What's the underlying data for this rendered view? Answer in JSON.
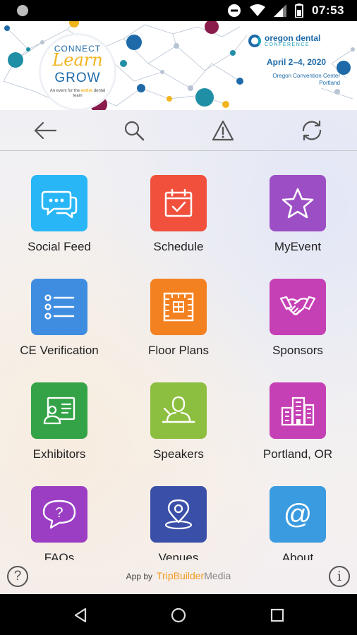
{
  "status_bar": {
    "time": "07:53"
  },
  "banner": {
    "connect": "CONNECT",
    "learn": "Learn",
    "grow": "GROW",
    "tagline_pre": "An event for the",
    "tagline_highlight": "entire",
    "tagline_post": "dental team",
    "org_name": "oregon dental",
    "org_sub": "CONFERENCE",
    "dates": "April 2–4, 2020",
    "venue_line1": "Oregon Convention Center",
    "venue_line2": "Portland"
  },
  "toolbar": {
    "back_icon": "arrow-left",
    "search_icon": "magnifier",
    "alert_icon": "warning-triangle",
    "refresh_icon": "refresh"
  },
  "tiles": [
    {
      "label": "Social Feed",
      "color": "#29b6f6",
      "icon": "chat-bubbles"
    },
    {
      "label": "Schedule",
      "color": "#f0503c",
      "icon": "calendar-check"
    },
    {
      "label": "MyEvent",
      "color": "#9c4fc4",
      "icon": "star"
    },
    {
      "label": "CE Verification",
      "color": "#3f8de0",
      "icon": "list"
    },
    {
      "label": "Floor Plans",
      "color": "#f48120",
      "icon": "floor-plan"
    },
    {
      "label": "Sponsors",
      "color": "#c640b5",
      "icon": "handshake"
    },
    {
      "label": "Exhibitors",
      "color": "#34a347",
      "icon": "exhibitor-board"
    },
    {
      "label": "Speakers",
      "color": "#8cbf3f",
      "icon": "speaker-podium"
    },
    {
      "label": "Portland, OR",
      "color": "#c640b5",
      "icon": "city-buildings"
    },
    {
      "label": "FAQs",
      "color": "#9b3ec4",
      "icon": "question-bubble"
    },
    {
      "label": "Venues",
      "color": "#3a4fa8",
      "icon": "map-pin"
    },
    {
      "label": "About",
      "color": "#3a9be0",
      "icon": "at-sign"
    }
  ],
  "footer": {
    "app_by": "App by",
    "brand_trip": "TripBuilder",
    "brand_media": "Media",
    "help_symbol": "?",
    "info_symbol": "i"
  }
}
